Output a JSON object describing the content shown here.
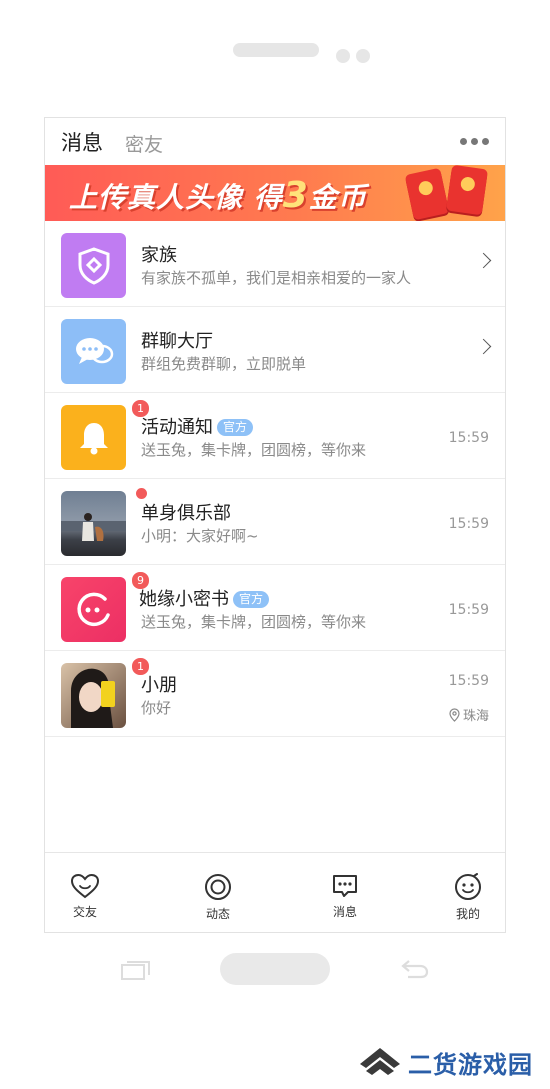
{
  "header": {
    "tab_messages": "消息",
    "tab_friends": "密友"
  },
  "banner": {
    "text_part1": "上传真人头像 得",
    "text_number": "3",
    "text_part2": "金币"
  },
  "conversations": [
    {
      "title": "家族",
      "subtitle": "有家族不孤单，我们是相亲相爱的一家人",
      "icon": "shield-icon",
      "color": "#c07cf2"
    },
    {
      "title": "群聊大厅",
      "subtitle": "群组免费群聊，立即脱单",
      "icon": "chat-bubbles-icon",
      "color": "#8dbef7"
    },
    {
      "title": "活动通知",
      "tag": "官方",
      "subtitle": "送玉兔，集卡牌，团圆榜，等你来",
      "time": "15:59",
      "badge": "1",
      "icon": "bell-icon",
      "color": "#fbb11c"
    },
    {
      "title": "单身俱乐部",
      "subtitle": "小明：大家好啊~",
      "time": "15:59",
      "icon": "group-photo"
    },
    {
      "title": "她缘小密书",
      "tag": "官方",
      "subtitle": "送玉兔，集卡牌，团圆榜，等你来",
      "time": "15:59",
      "badge": "9",
      "icon": "secretary-icon",
      "color": "#f0416b"
    },
    {
      "title": "小朋",
      "subtitle": "你好",
      "time": "15:59",
      "badge": "1",
      "location": "珠海",
      "icon": "user-photo"
    }
  ],
  "nav": [
    {
      "label": "交友",
      "icon": "heart-icon"
    },
    {
      "label": "动态",
      "icon": "moments-icon"
    },
    {
      "label": "消息",
      "icon": "message-icon"
    },
    {
      "label": "我的",
      "icon": "face-icon"
    }
  ],
  "watermark": {
    "text": "二货游戏园"
  }
}
